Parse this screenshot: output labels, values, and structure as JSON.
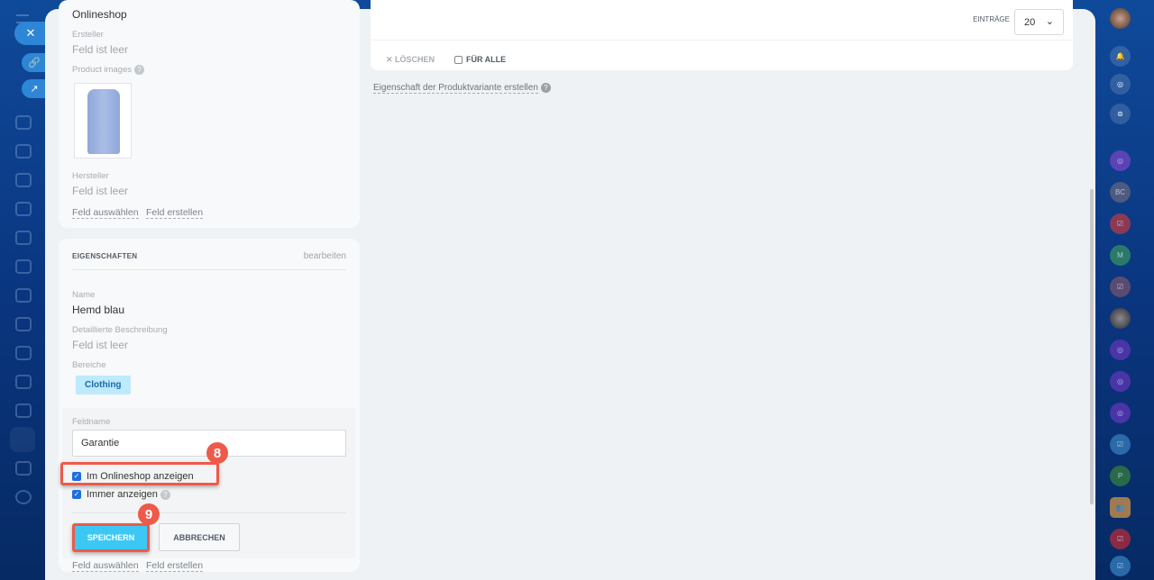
{
  "left_card": {
    "title": "Onlineshop",
    "creator_label": "Ersteller",
    "creator_value": "Feld ist leer",
    "images_label": "Product images",
    "maker_label": "Hersteller",
    "maker_value": "Feld ist leer",
    "select_field": "Feld auswählen",
    "create_field": "Feld erstellen"
  },
  "properties": {
    "title": "EIGENSCHAFTEN",
    "edit": "bearbeiten",
    "name_label": "Name",
    "name_value": "Hemd blau",
    "desc_label": "Detaillierte Beschreibung",
    "desc_value": "Feld ist leer",
    "area_label": "Bereiche",
    "area_tag": "Clothing",
    "fieldname_label": "Feldname",
    "fieldname_value": "Garantie",
    "check1": "Im Onlineshop anzeigen",
    "check2": "Immer anzeigen",
    "save": "SPEICHERN",
    "cancel": "ABBRECHEN",
    "select_field": "Feld auswählen",
    "create_field": "Feld erstellen"
  },
  "right": {
    "entries_label": "EINTRÄGE",
    "entries_value": "20",
    "delete": "LÖSCHEN",
    "for_all": "FÜR ALLE",
    "create_variant_property": "Eigenschaft der Produktvariante erstellen"
  },
  "badges": {
    "step8": "8",
    "step9": "9"
  },
  "right_sidebar": [
    "BC",
    "M",
    "P"
  ]
}
